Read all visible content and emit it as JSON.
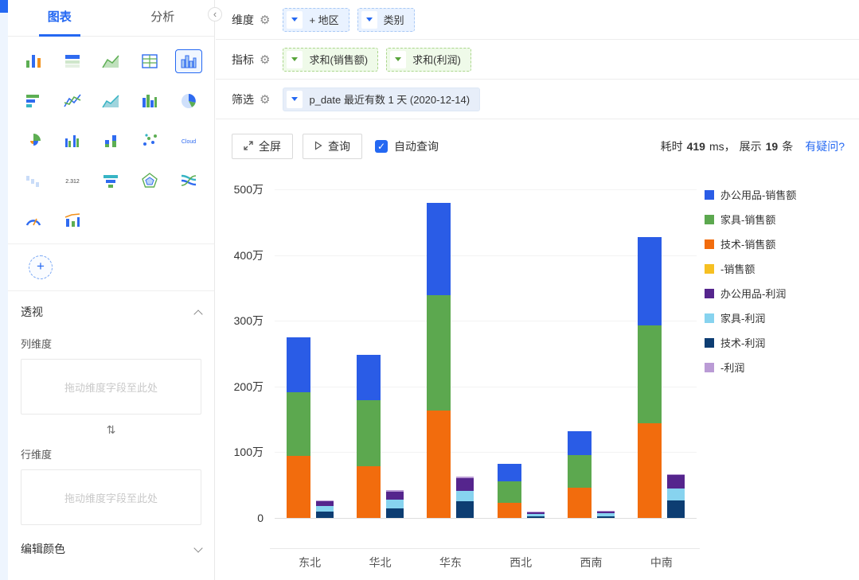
{
  "window": {
    "collapse_icon": "‹"
  },
  "sidebar": {
    "tabs": [
      {
        "label": "图表",
        "active": true
      },
      {
        "label": "分析",
        "active": false
      }
    ],
    "chart_icons": [
      {
        "name": "colored-bar",
        "type": "bars",
        "selected": false
      },
      {
        "name": "table",
        "type": "table",
        "selected": false
      },
      {
        "name": "trend-area",
        "type": "area",
        "selected": false
      },
      {
        "name": "data-grid",
        "type": "table2",
        "selected": false
      },
      {
        "name": "column",
        "type": "histogram",
        "selected": true
      },
      {
        "name": "horizontal-bar",
        "type": "hbar",
        "selected": false
      },
      {
        "name": "line",
        "type": "line",
        "selected": false
      },
      {
        "name": "area-chart",
        "type": "area2",
        "selected": false
      },
      {
        "name": "interval-column",
        "type": "bars2",
        "selected": false
      },
      {
        "name": "pie",
        "type": "pie",
        "selected": false
      },
      {
        "name": "rose",
        "type": "rose",
        "selected": false
      },
      {
        "name": "grouped-bar",
        "type": "grouped",
        "selected": false
      },
      {
        "name": "stacked-bar",
        "type": "stacked",
        "selected": false
      },
      {
        "name": "scatter",
        "type": "scatter",
        "selected": false
      },
      {
        "name": "word-cloud",
        "type": "text",
        "text": "Cloud",
        "selected": false
      },
      {
        "name": "waterfall",
        "type": "bars3",
        "selected": false
      },
      {
        "name": "metric-card",
        "type": "text",
        "text": "2.312",
        "selected": false
      },
      {
        "name": "funnel",
        "type": "funnel",
        "selected": false
      },
      {
        "name": "radar",
        "type": "radar",
        "selected": false
      },
      {
        "name": "sankey",
        "type": "sankey",
        "selected": false
      },
      {
        "name": "gauge",
        "type": "gauge",
        "selected": false
      },
      {
        "name": "combo",
        "type": "combo",
        "selected": false
      }
    ],
    "add_button_label": "+",
    "pivot_title": "透视",
    "col_dim_label": "列维度",
    "col_dropzone": "拖动维度字段至此处",
    "row_dim_label": "行维度",
    "row_dropzone": "拖动维度字段至此处",
    "edit_color_title": "编辑颜色",
    "swap_icon": "⇅"
  },
  "config": {
    "dimension_label": "维度",
    "dimension_pills": [
      "+ 地区",
      "类别"
    ],
    "metric_label": "指标",
    "metric_pills": [
      "求和(销售额)",
      "求和(利润)"
    ],
    "filter_label": "筛选",
    "filter_pills": [
      "p_date 最近有数 1 天 (2020-12-14)"
    ]
  },
  "toolbar": {
    "fullscreen": "全屏",
    "query": "查询",
    "auto_query": "自动查询",
    "auto_query_checked": true,
    "elapsed_prefix": "耗时",
    "elapsed_value": "419",
    "elapsed_unit": "ms，",
    "display_prefix": "展示",
    "display_count": "19",
    "display_unit": "条",
    "question_link": "有疑问?"
  },
  "chart_data": {
    "type": "bar",
    "stacked": true,
    "unit": "万",
    "ylim": [
      0,
      500
    ],
    "ytick_labels": [
      "0",
      "100万",
      "200万",
      "300万",
      "400万",
      "500万"
    ],
    "categories": [
      "东北",
      "华北",
      "华东",
      "西北",
      "西南",
      "中南"
    ],
    "series": [
      {
        "name": "技术-销售额",
        "group": "sales",
        "color": "#f26c0d",
        "values": [
          95,
          79,
          163,
          23,
          46,
          144
        ]
      },
      {
        "name": "家具-销售额",
        "group": "sales",
        "color": "#5ca84f",
        "values": [
          96,
          100,
          176,
          33,
          50,
          149
        ]
      },
      {
        "name": "办公用品-销售额",
        "group": "sales",
        "color": "#2a5ce6",
        "values": [
          84,
          69,
          141,
          26,
          36,
          134
        ]
      },
      {
        "name": "-销售额",
        "group": "sales",
        "color": "#f6c022",
        "values": [
          0,
          0,
          0,
          0,
          0,
          0
        ]
      },
      {
        "name": "技术-利润",
        "group": "profit",
        "color": "#0d3d72",
        "values": [
          10,
          14,
          25,
          3,
          3,
          27
        ]
      },
      {
        "name": "家具-利润",
        "group": "profit",
        "color": "#87d3ef",
        "values": [
          8,
          14,
          16,
          3,
          4,
          18
        ]
      },
      {
        "name": "办公用品-利润",
        "group": "profit",
        "color": "#55258d",
        "values": [
          8,
          12,
          20,
          3,
          3,
          20
        ]
      },
      {
        "name": "-利润",
        "group": "profit",
        "color": "#ba9bd5",
        "values": [
          1,
          2,
          2,
          1,
          1,
          2
        ]
      }
    ],
    "legend": [
      {
        "label": "办公用品-销售额",
        "color": "#2a5ce6"
      },
      {
        "label": "家具-销售额",
        "color": "#5ca84f"
      },
      {
        "label": "技术-销售额",
        "color": "#f26c0d"
      },
      {
        "label": "-销售额",
        "color": "#f6c022"
      },
      {
        "label": "办公用品-利润",
        "color": "#55258d"
      },
      {
        "label": "家具-利润",
        "color": "#87d3ef"
      },
      {
        "label": "技术-利润",
        "color": "#0d3d72"
      },
      {
        "label": "-利润",
        "color": "#ba9bd5"
      }
    ]
  }
}
